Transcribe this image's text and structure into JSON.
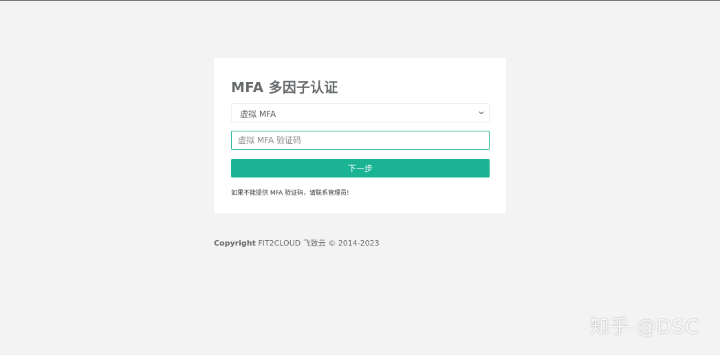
{
  "login": {
    "title": "MFA 多因子认证",
    "mfa_select": {
      "selected": "虚拟 MFA"
    },
    "code_input": {
      "placeholder": "虚拟 MFA 验证码",
      "value": ""
    },
    "next_button_label": "下一步",
    "help_text": "如果不能提供 MFA 验证码，请联系管理员!"
  },
  "footer": {
    "copyright_label": "Copyright",
    "copyright_text": " FIT2CLOUD 飞致云 © 2014-2023"
  },
  "watermark": {
    "text": "知乎 @DSC"
  },
  "colors": {
    "accent": "#1ab394",
    "background": "#f3f3f4",
    "card": "#ffffff"
  },
  "icons": {
    "select_arrow": "chevron-down-icon"
  }
}
